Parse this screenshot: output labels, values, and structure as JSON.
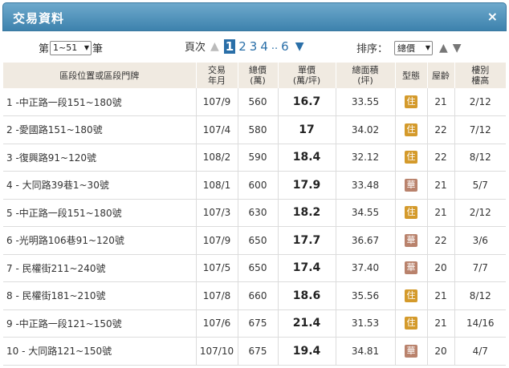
{
  "window": {
    "title": "交易資料",
    "close_symbol": "×"
  },
  "controls": {
    "range_prefix": "第",
    "range_value": "1~51",
    "range_suffix": "筆",
    "page_label": "頁次",
    "pages": [
      "1",
      "2",
      "3",
      "4"
    ],
    "current_page": "1",
    "ellipsis": "..",
    "last_page": "6",
    "sort_label": "排序：",
    "sort_value": "總價"
  },
  "colors": {
    "badge_residential": "#d49a2b",
    "badge_mansion": "#b9826c",
    "page_link": "#2a6fa8",
    "title_bar": "#4d8fba"
  },
  "table": {
    "headers": [
      [
        "區段位置或區段門牌"
      ],
      [
        "交易",
        "年月"
      ],
      [
        "總價",
        "(萬)"
      ],
      [
        "單價",
        "(萬/坪)"
      ],
      [
        "總面積",
        "(坪)"
      ],
      [
        "型態"
      ],
      [
        "屋齡"
      ],
      [
        "樓別",
        "樓高"
      ]
    ],
    "rows": [
      {
        "addr": "1 -中正路一段151~180號",
        "date": "107/9",
        "total": "560",
        "unit": "16.7",
        "area": "33.55",
        "type": "住",
        "type_color": "#d49a2b",
        "age": "21",
        "floor": "2/12"
      },
      {
        "addr": "2 -愛國路151~180號",
        "date": "107/4",
        "total": "580",
        "unit": "17",
        "area": "34.02",
        "type": "住",
        "type_color": "#d49a2b",
        "age": "22",
        "floor": "7/12"
      },
      {
        "addr": "3 -復興路91~120號",
        "date": "108/2",
        "total": "590",
        "unit": "18.4",
        "area": "32.12",
        "type": "住",
        "type_color": "#d49a2b",
        "age": "22",
        "floor": "8/12"
      },
      {
        "addr": "4 - 大同路39巷1~30號",
        "date": "108/1",
        "total": "600",
        "unit": "17.9",
        "area": "33.48",
        "type": "華",
        "type_color": "#b9826c",
        "age": "21",
        "floor": "5/7"
      },
      {
        "addr": "5 -中正路一段151~180號",
        "date": "107/3",
        "total": "630",
        "unit": "18.2",
        "area": "34.55",
        "type": "住",
        "type_color": "#d49a2b",
        "age": "21",
        "floor": "2/12"
      },
      {
        "addr": "6 -光明路106巷91~120號",
        "date": "107/9",
        "total": "650",
        "unit": "17.7",
        "area": "36.67",
        "type": "華",
        "type_color": "#b9826c",
        "age": "22",
        "floor": "3/6"
      },
      {
        "addr": "7 - 民權街211~240號",
        "date": "107/5",
        "total": "650",
        "unit": "17.4",
        "area": "37.40",
        "type": "華",
        "type_color": "#b9826c",
        "age": "20",
        "floor": "7/7"
      },
      {
        "addr": "8 - 民權街181~210號",
        "date": "107/8",
        "total": "660",
        "unit": "18.6",
        "area": "35.56",
        "type": "住",
        "type_color": "#d49a2b",
        "age": "21",
        "floor": "8/12"
      },
      {
        "addr": "9 -中正路一段121~150號",
        "date": "107/6",
        "total": "675",
        "unit": "21.4",
        "area": "31.53",
        "type": "住",
        "type_color": "#d49a2b",
        "age": "21",
        "floor": "14/16"
      },
      {
        "addr": "10 - 大同路121~150號",
        "date": "107/10",
        "total": "675",
        "unit": "19.4",
        "area": "34.81",
        "type": "華",
        "type_color": "#b9826c",
        "age": "20",
        "floor": "4/7"
      }
    ]
  }
}
